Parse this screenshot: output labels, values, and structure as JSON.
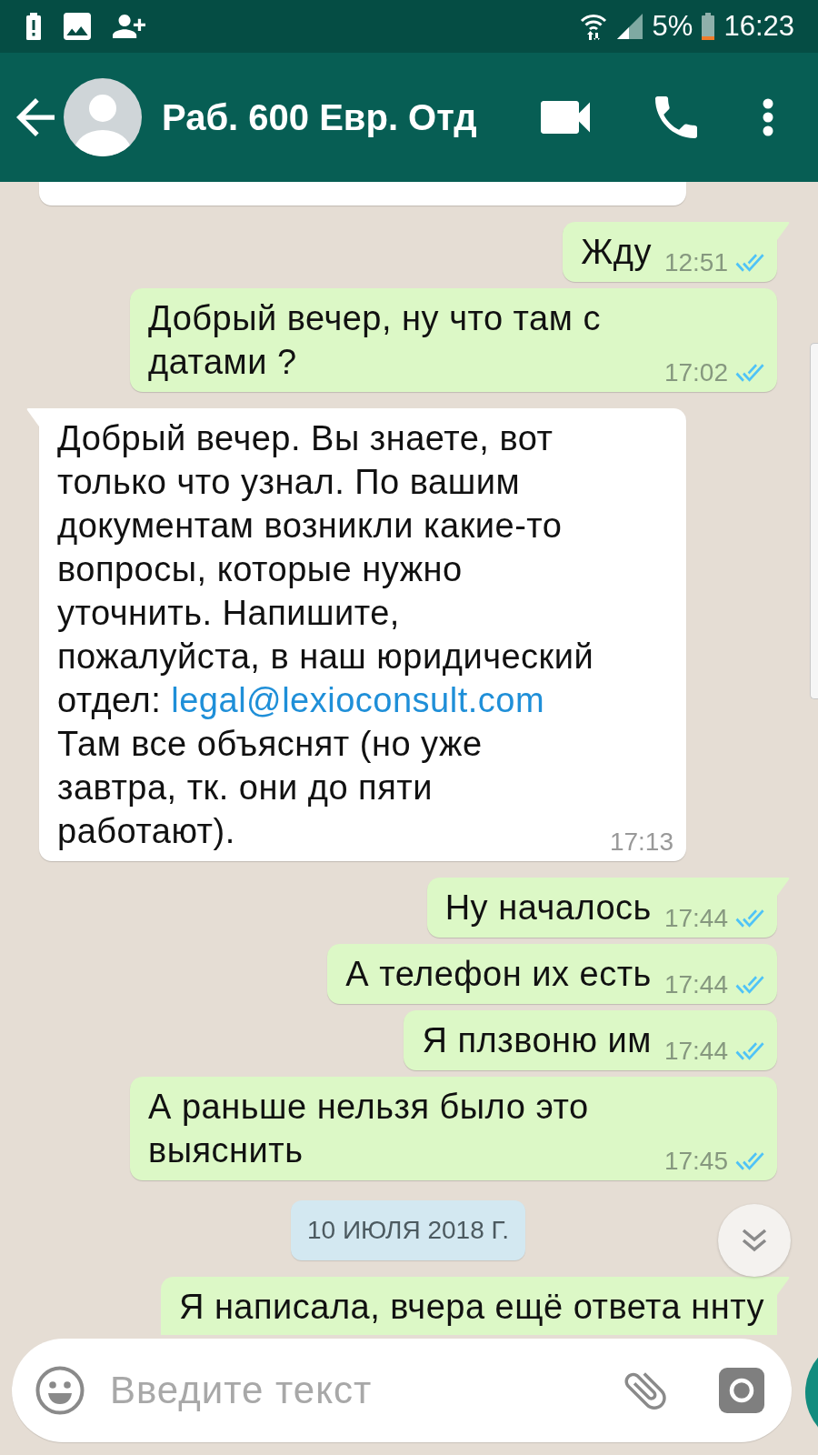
{
  "status_bar": {
    "battery": "5%",
    "time": "16:23"
  },
  "header": {
    "title": "Раб. 600 Евр. Отд"
  },
  "messages": [
    {
      "kind": "cut_top",
      "outgoing": false
    },
    {
      "kind": "text",
      "outgoing": true,
      "tail": true,
      "text": "Жду",
      "time": "12:51",
      "read": true
    },
    {
      "kind": "text",
      "outgoing": true,
      "tail": false,
      "text": "Добрый вечер, ну что там с датами ?",
      "time": "17:02",
      "read": true
    },
    {
      "kind": "text",
      "outgoing": false,
      "tail": true,
      "segments": [
        {
          "kind": "plain",
          "text": "Добрый вечер. Вы знаете, вот только что узнал. По вашим документам возникли какие-то вопросы, которые нужно уточнить. Напишите, пожалуйста, в наш юридический отдел: "
        },
        {
          "kind": "link",
          "text": "legal@lexioconsult.com"
        },
        {
          "kind": "plain",
          "text": " Там все объяснят (но уже завтра, тк. они до пяти работают)."
        }
      ],
      "time": "17:13"
    },
    {
      "kind": "text",
      "outgoing": true,
      "tail": true,
      "text": "Ну началось",
      "time": "17:44",
      "read": true
    },
    {
      "kind": "text",
      "outgoing": true,
      "tail": false,
      "text": "А телефон их есть",
      "time": "17:44",
      "read": true
    },
    {
      "kind": "text",
      "outgoing": true,
      "tail": false,
      "text": "Я плзвоню им",
      "time": "17:44",
      "read": true
    },
    {
      "kind": "text",
      "outgoing": true,
      "tail": false,
      "text": "А раньше нельзя было это выяснить",
      "time": "17:45",
      "read": true
    },
    {
      "kind": "date",
      "text": "10 ИЮЛЯ 2018 Г."
    },
    {
      "kind": "cut_bottom",
      "outgoing": true,
      "tail": true,
      "text": "Я написала, вчера ещё ответа ннту"
    }
  ],
  "composer": {
    "placeholder": "Введите текст"
  }
}
